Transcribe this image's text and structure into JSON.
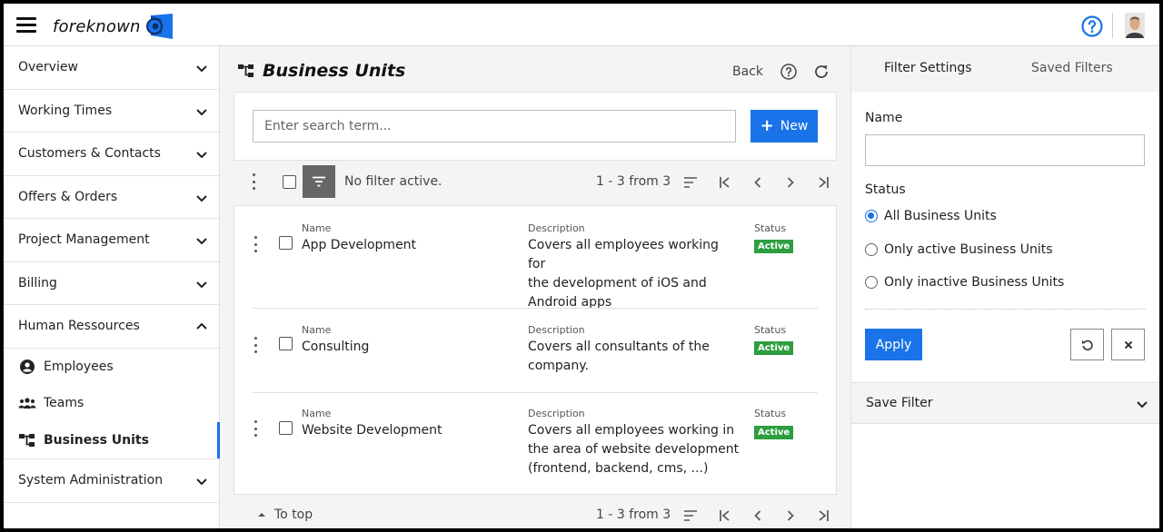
{
  "app": {
    "logo_text": "foreknown"
  },
  "sidebar": {
    "items": [
      {
        "label": "Overview"
      },
      {
        "label": "Working Times"
      },
      {
        "label": "Customers & Contacts"
      },
      {
        "label": "Offers & Orders"
      },
      {
        "label": "Project Management"
      },
      {
        "label": "Billing"
      },
      {
        "label": "Human Ressources"
      }
    ],
    "sub_items": [
      {
        "label": "Employees",
        "icon": "user-circle-icon"
      },
      {
        "label": "Teams",
        "icon": "team-icon"
      },
      {
        "label": "Business Units",
        "icon": "hierarchy-icon"
      }
    ],
    "last_item": {
      "label": "System Administration"
    }
  },
  "main": {
    "title": "Business Units",
    "back_label": "Back",
    "search": {
      "placeholder": "Enter search term..."
    },
    "new_label": "New",
    "filter_status": "No filter active.",
    "pager_text": "1 - 3 from 3",
    "to_top_label": "To top",
    "labels": {
      "name": "Name",
      "description": "Description",
      "status": "Status"
    },
    "rows": [
      {
        "name": "App Development",
        "description_lines": [
          "Covers all employees working for",
          "the development of iOS and",
          "Android apps"
        ],
        "status": "Active"
      },
      {
        "name": "Consulting",
        "description_lines": [
          "Covers all consultants of the",
          "company."
        ],
        "status": "Active"
      },
      {
        "name": "Website Development",
        "description_lines": [
          "Covers all employees working in",
          "the area of website development",
          "(frontend, backend, cms, ...)"
        ],
        "status": "Active"
      }
    ]
  },
  "filter_panel": {
    "tab_filter": "Filter Settings",
    "tab_saved": "Saved Filters",
    "name_label": "Name",
    "name_value": "",
    "status_label": "Status",
    "options": [
      {
        "label": "All Business Units",
        "selected": true
      },
      {
        "label": "Only active Business Units",
        "selected": false
      },
      {
        "label": "Only inactive Business Units",
        "selected": false
      }
    ],
    "apply_label": "Apply",
    "save_filter_label": "Save Filter"
  },
  "colors": {
    "accent": "#1a73e8",
    "active_badge": "#2e9e3f"
  }
}
